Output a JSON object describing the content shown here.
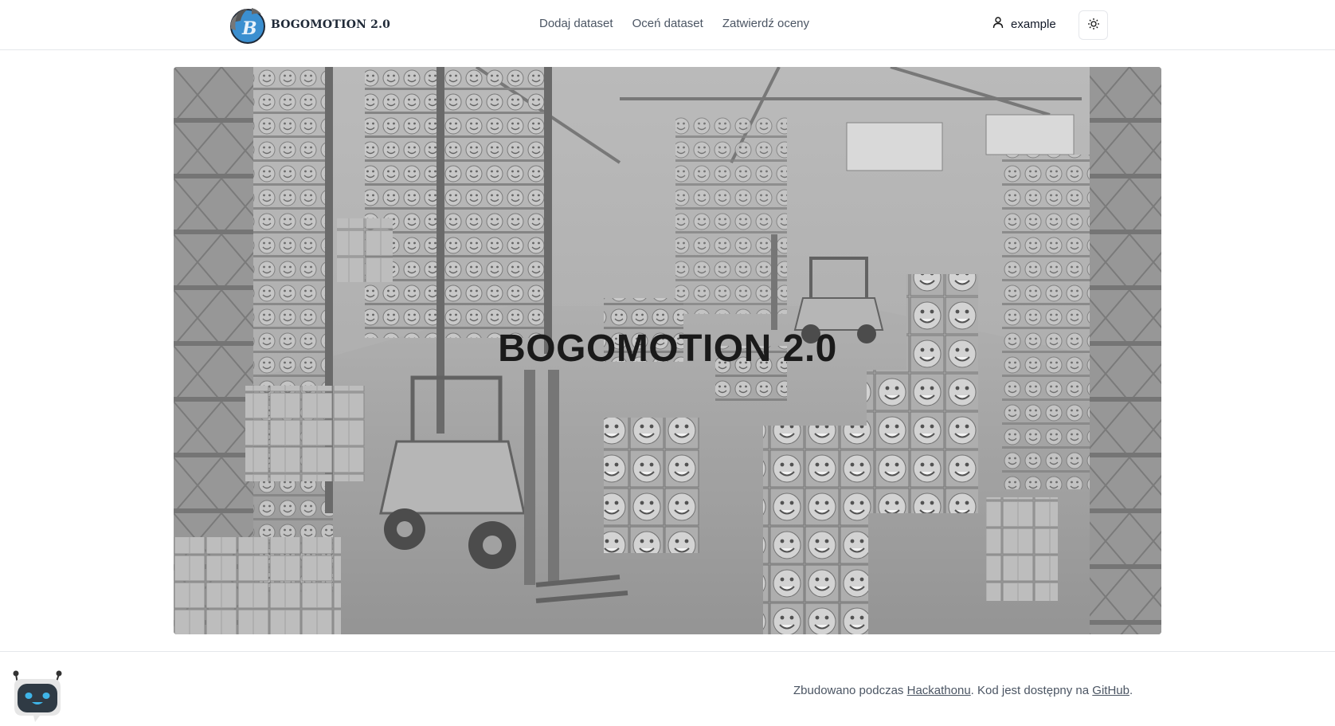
{
  "brand": {
    "name": "BOGOMOTION 2.0",
    "logo_letter": "B"
  },
  "nav": {
    "items": [
      {
        "label": "Dodaj dataset"
      },
      {
        "label": "Oceń dataset"
      },
      {
        "label": "Zatwierdź oceny"
      }
    ]
  },
  "user": {
    "name": "example",
    "icon": "user-icon"
  },
  "theme_toggle": {
    "icon": "sun-icon"
  },
  "hero": {
    "title": "BOGOMOTION 2.0"
  },
  "footer": {
    "prefix": "Zbudowano podczas ",
    "hackathon_link": "Hackathonu",
    "middle": ". Kod jest dostępny na ",
    "github_link": "GitHub",
    "suffix": "."
  },
  "chatbot": {
    "icon": "robot-icon"
  },
  "colors": {
    "accent": "#3b8fd0",
    "border": "#e5e7eb",
    "text_muted": "#4b5563"
  }
}
